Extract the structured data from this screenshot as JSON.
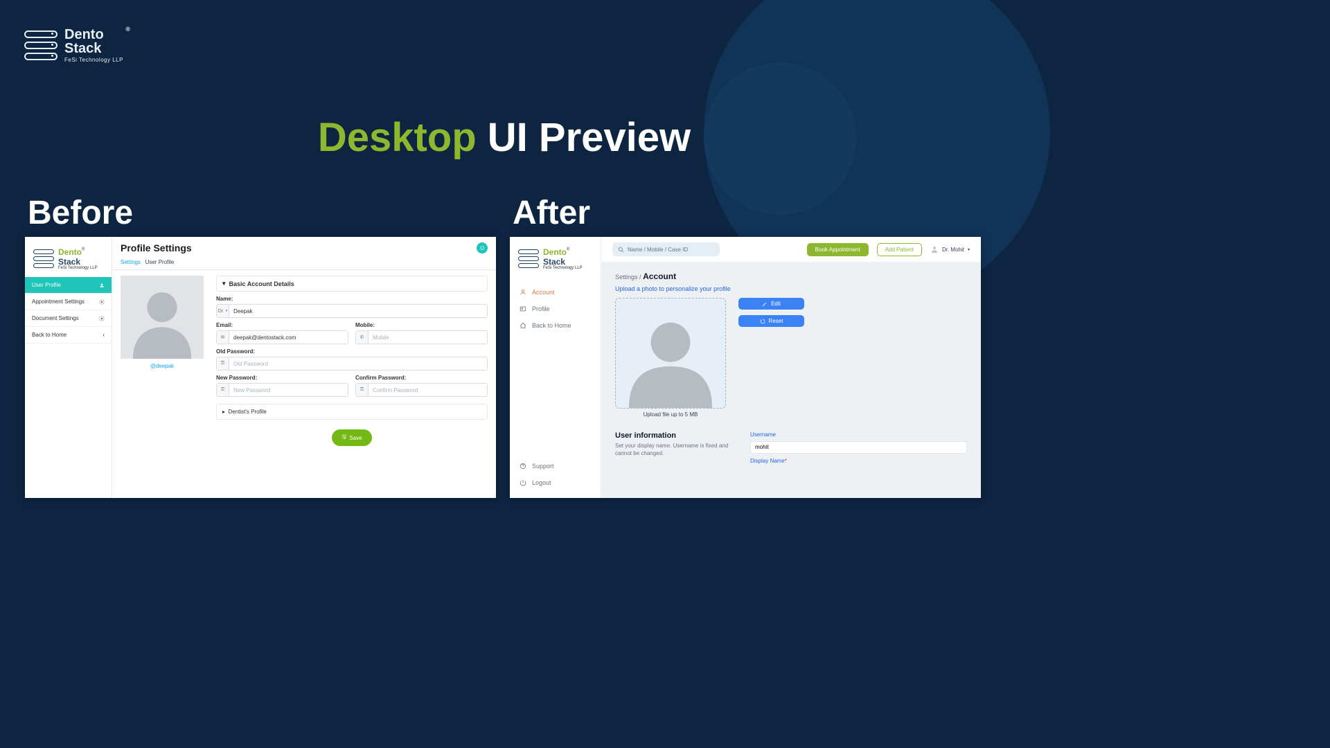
{
  "brand": {
    "line1": "Dento",
    "line2": "Stack",
    "sub": "FeSi Technology LLP"
  },
  "headline": {
    "green": "Desktop",
    "white": "UI Preview"
  },
  "labels": {
    "before": "Before",
    "after": "After"
  },
  "before": {
    "title": "Profile Settings",
    "breadcrumb": {
      "root": "Settings",
      "current": "User Profile"
    },
    "nav": {
      "userProfile": "User Profile",
      "appointmentSettings": "Appointment Settings",
      "documentSettings": "Document Settings",
      "backHome": "Back to Home"
    },
    "avatarCaption": "@deepak",
    "accordion": {
      "basic": "Basic Account Details",
      "dentist": "Dentist's Profile"
    },
    "fields": {
      "nameLabel": "Name:",
      "namePrefix": "Dr.",
      "nameValue": "Deepak",
      "emailLabel": "Email:",
      "emailValue": "deepak@dentostack.com",
      "mobileLabel": "Mobile:",
      "mobilePlaceholder": "Mobile",
      "oldPwdLabel": "Old Password:",
      "oldPwdPlaceholder": "Old Password",
      "newPwdLabel": "New Password:",
      "newPwdPlaceholder": "New Password",
      "confirmPwdLabel": "Confirm Password:",
      "confirmPwdPlaceholder": "Confirm Password"
    },
    "saveBtn": "Save"
  },
  "after": {
    "search": "Name / Mobile / Case ID",
    "buttons": {
      "book": "Book Appointment",
      "add": "Add Patient"
    },
    "userName": "Dr. Mohit",
    "nav": {
      "account": "Account",
      "profile": "Profile",
      "backHome": "Back to Home",
      "support": "Support",
      "logout": "Logout"
    },
    "breadcrumb": {
      "root": "Settings",
      "current": "Account"
    },
    "uploadHint": "Upload a photo to personalize your profile",
    "uploadCaption": "Upload file up to 5 MB",
    "editBtn": "Edit",
    "resetBtn": "Reset",
    "userInfo": {
      "title": "User information",
      "desc": "Set your display name. Username is fixed and cannot be changed.",
      "usernameLabel": "Username",
      "usernameValue": "mohit",
      "displayNameLabel": "Display Name"
    }
  }
}
